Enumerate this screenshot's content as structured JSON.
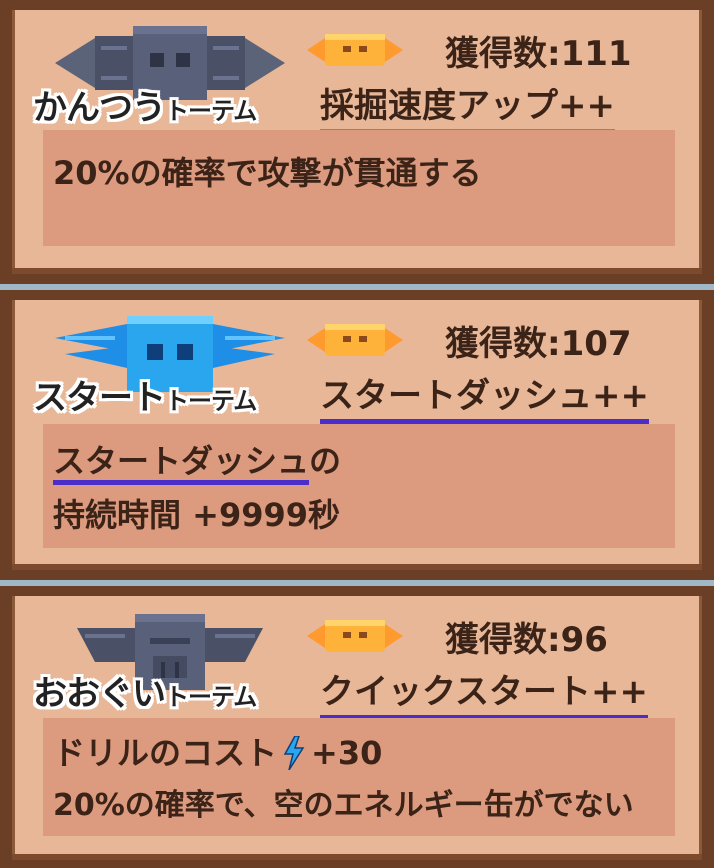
{
  "cards": [
    {
      "totem_name_main": "かんつう",
      "totem_name_suffix": "トーテム",
      "count_label": "獲得数:",
      "count_value": "111",
      "skill": "採掘速度アップ++",
      "desc_lines": [
        "20%の確率で攻撃が貫通する"
      ],
      "icon": "gray-drill-totem-icon",
      "underline_color": "#29a3e6"
    },
    {
      "totem_name_main": "スタート",
      "totem_name_suffix": "トーテム",
      "count_label": "獲得数:",
      "count_value": "107",
      "skill": "スタートダッシュ++",
      "desc_line1_link": "スタートダッシュ",
      "desc_line1_rest": "の",
      "desc_line2": "持続時間 +9999秒",
      "icon": "blue-winged-totem-icon",
      "underline_color": "#4b2ec9"
    },
    {
      "totem_name_main": "おおぐい",
      "totem_name_suffix": "トーテム",
      "count_label": "獲得数:",
      "count_value": "96",
      "skill": "クイックスタート++",
      "desc_line1_pre": "ドリルのコスト",
      "desc_line1_post": "+30",
      "desc_line2": "20%の確率で、空のエネルギー缶がでない",
      "icon": "gray-glutton-totem-icon",
      "underline_color": "#4b2ec9"
    }
  ],
  "colors": {
    "frame": "#6b3f26",
    "panel": "#e8b797",
    "desc_panel": "#dc9a7e",
    "text": "#3b2318"
  }
}
